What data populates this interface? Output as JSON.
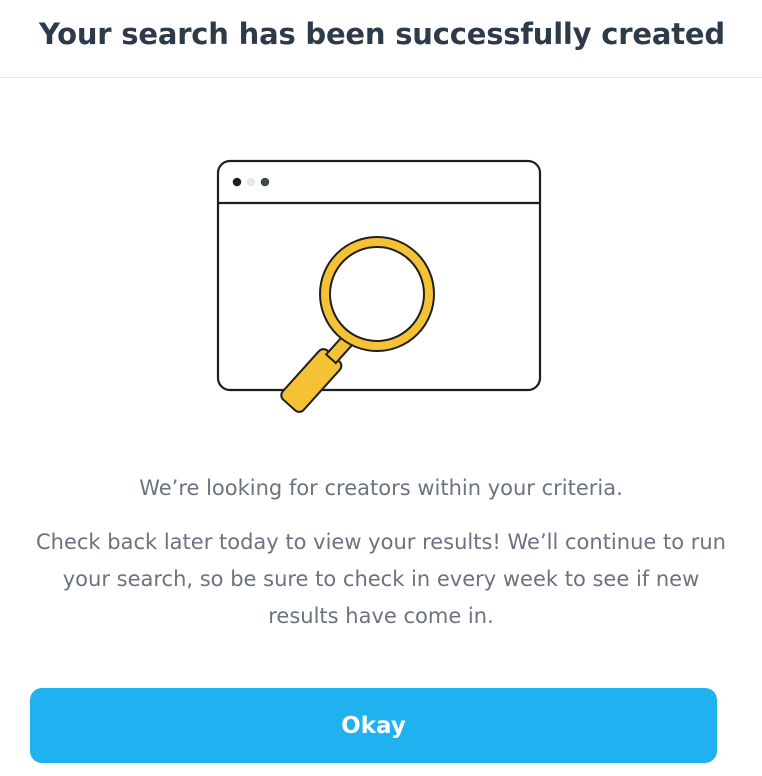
{
  "modal": {
    "title": "Your search has been successfully created",
    "illustration": {
      "name": "browser-window-magnifier-illustration",
      "accent_color": "#f5c135",
      "outline_color": "#1f1f1f"
    },
    "primary_message": "We’re looking for creators within your criteria.",
    "secondary_message": "Check back later today to view your results! We’ll continue to run your search, so be sure to check in every week to see if new results have come in.",
    "okay_label": "Okay"
  },
  "colors": {
    "title": "#2d3a4a",
    "body_text": "#6b7280",
    "button": "#1fb1f0",
    "button_text": "#ffffff",
    "divider": "#e6e8ec"
  }
}
